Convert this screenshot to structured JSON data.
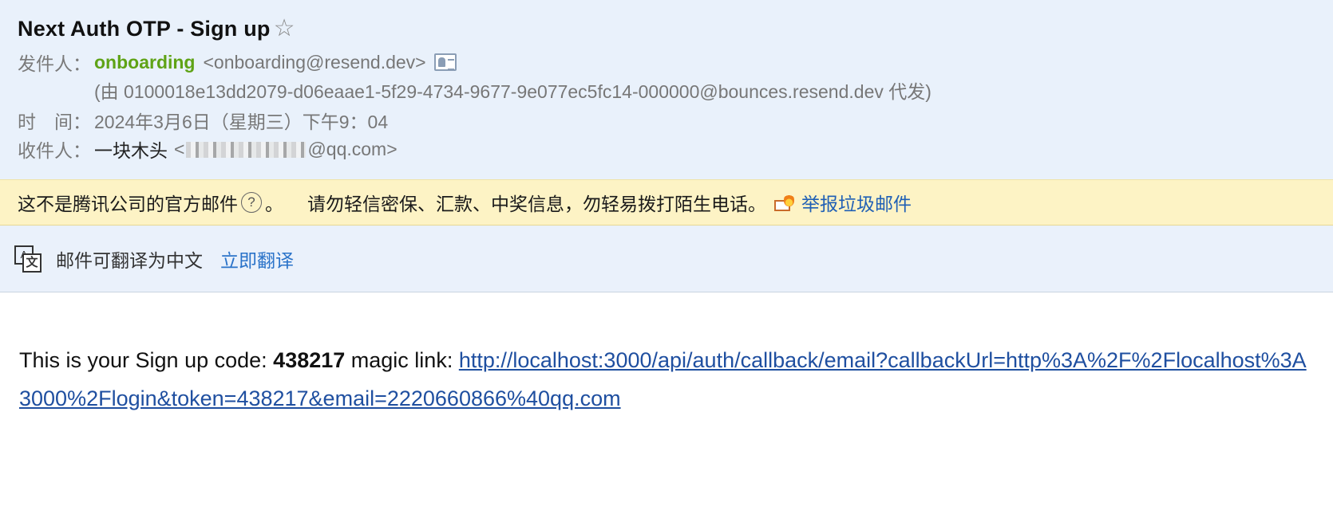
{
  "email": {
    "subject": "Next Auth OTP - Sign up",
    "star_glyph": "☆",
    "from_label": "发件人：",
    "sender_name": "onboarding",
    "sender_address": "<onboarding@resend.dev>",
    "via": "(由 0100018e13dd2079-d06eaae1-5f29-4734-9677-9e077ec5fc14-000000@bounces.resend.dev 代发)",
    "time_label": "时　间：",
    "time_value": "2024年3月6日（星期三）下午9：04",
    "to_label": "收件人：",
    "recipient_name": "一块木头",
    "recipient_address_prefix": "<",
    "recipient_address_suffix": "@qq.com>"
  },
  "warning": {
    "text": "这不是腾讯公司的官方邮件",
    "help_glyph": "?",
    "period": "。",
    "tip": "请勿轻信密保、汇款、中奖信息，勿轻易拨打陌生电话。",
    "report_label": "举报垃圾邮件"
  },
  "translate": {
    "icon_glyph_a": "A",
    "icon_glyph_b": "文",
    "text": "邮件可翻译为中文",
    "action": "立即翻译"
  },
  "body": {
    "prefix": "This is your Sign up code: ",
    "code": "438217",
    "middle": " magic link: ",
    "link": "http://localhost:3000/api/auth/callback/email?callbackUrl=http%3A%2F%2Flocalhost%3A3000%2Flogin&token=438217&email=2220660866%40qq.com"
  },
  "colors": {
    "header_bg": "#e9f1fb",
    "warning_bg": "#fdf3c5",
    "sender_green": "#5fa316",
    "link_blue": "#1f5fb5"
  }
}
